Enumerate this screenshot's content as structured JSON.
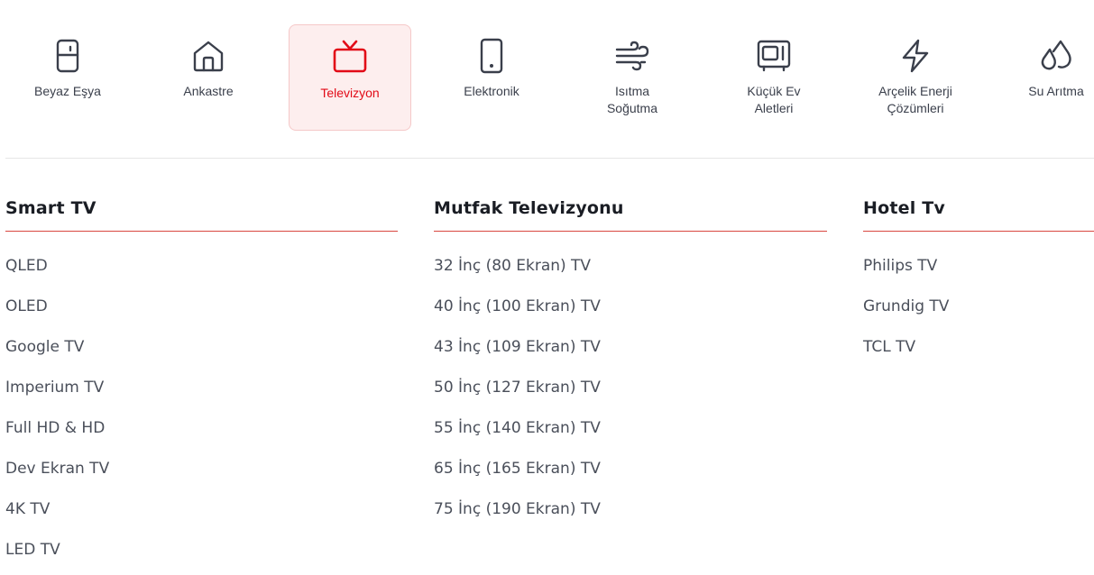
{
  "categories": [
    {
      "label": "Beyaz Eşya",
      "icon": "fridge-icon",
      "active": false
    },
    {
      "label": "Ankastre",
      "icon": "house-icon",
      "active": false
    },
    {
      "label": "Televizyon",
      "icon": "tv-icon",
      "active": true
    },
    {
      "label": "Elektronik",
      "icon": "phone-icon",
      "active": false
    },
    {
      "label": "Isıtma\nSoğutma",
      "icon": "wind-icon",
      "active": false
    },
    {
      "label": "Küçük Ev\nAletleri",
      "icon": "microwave-icon",
      "active": false
    },
    {
      "label": "Arçelik Enerji\nÇözümleri",
      "icon": "lightning-icon",
      "active": false
    },
    {
      "label": "Su Arıtma",
      "icon": "water-drops-icon",
      "active": false
    }
  ],
  "colors": {
    "accent": "#e20a17",
    "active_bg": "#fdeeee",
    "rule": "#d9473f",
    "text": "#3a3f4b"
  },
  "columns": [
    {
      "title": "Smart TV",
      "items": [
        "QLED",
        "OLED",
        "Google TV",
        "Imperium TV",
        "Full HD & HD",
        "Dev Ekran TV",
        "4K TV",
        "LED TV"
      ]
    },
    {
      "title": "Mutfak Televizyonu",
      "items": [
        "32 İnç (80 Ekran) TV",
        "40 İnç (100 Ekran) TV",
        "43 İnç (109 Ekran) TV",
        "50 İnç (127 Ekran) TV",
        "55 İnç (140 Ekran) TV",
        "65 İnç (165 Ekran) TV",
        "75 İnç (190 Ekran) TV"
      ]
    },
    {
      "title": "Hotel Tv",
      "items": [
        "Philips TV",
        "Grundig TV",
        "TCL TV"
      ]
    }
  ]
}
